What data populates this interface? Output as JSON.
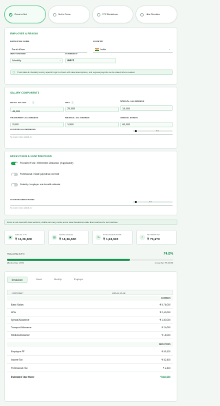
{
  "tabs": [
    {
      "label": "Gross to Net",
      "active": true
    },
    {
      "label": "Net to Gross",
      "active": false
    },
    {
      "label": "CTC Breakdown",
      "active": false
    },
    {
      "label": "Hike Simulator",
      "active": false
    }
  ],
  "employee": {
    "title": "EMPLOYEE & REGION",
    "name_label": "EMPLOYEE NAME",
    "name_value": "Sarah Khan",
    "country_label": "COUNTRY",
    "country_value": "India",
    "period_label": "INPUT PERIOD",
    "period_value": "Monthly",
    "currency_label": "CURRENCY",
    "currency_value": "INR ₹",
    "note": "Trust slabs & cheddar( country-specific logic is shown with clear assumptions, and regional payrolls can be stated where needed."
  },
  "salary": {
    "title": "SALARY COMPONENTS",
    "fields": [
      {
        "label": "BASIC SALARY",
        "value": "48,000"
      },
      {
        "label": "HRA",
        "value": "20,000"
      },
      {
        "label": "SPECIAL ALLOWANCE",
        "value": "15,000"
      },
      {
        "label": "TRANSPORT ALLOWANCE",
        "value": "2,000"
      },
      {
        "label": "MEDICAL ALLOWANCE",
        "value": "1,500"
      },
      {
        "label": "ANNUAL BONUS",
        "value": "60,000"
      }
    ],
    "custom_label": "CUSTOM ALLOWANCES",
    "custom_value": "₹ 0",
    "custom_help": "No custom items added yet"
  },
  "deductions": {
    "title": "DEDUCTIONS & CONTRIBUTIONS",
    "toggles": [
      {
        "label": "Provident Fund / Retirement Deduction (if applicable)",
        "on": true
      },
      {
        "label": "Professional / State payroll tax override",
        "on": false
      },
      {
        "label": "Gratuity / employer end-benefit estimate",
        "on": false
      }
    ],
    "custom_label": "CUSTOM DEDUCTIONS",
    "custom_value": "₹ 0",
    "custom_help": "No custom items added yet"
  },
  "banner": "Gross to net view with clear sections, visible summary cards, and a clean breakdown table that matches the tool interface.",
  "stats": [
    {
      "icon": "wallet-icon",
      "glyph": "▣",
      "label": "ANNUAL CTC",
      "value": "₹ 11,20,300"
    },
    {
      "icon": "cash-icon",
      "glyph": "▤",
      "label": "GROSS ANNUAL",
      "value": "₹ 10,36,000"
    },
    {
      "icon": "percent-icon",
      "glyph": "%",
      "label": "TOTAL DEDUCTIONS",
      "value": "₹ 1,53,020"
    },
    {
      "icon": "check-icon",
      "glyph": "✓",
      "label": "NET MONTHLY",
      "value": "₹ 73,673"
    }
  ],
  "take_home": {
    "label": "TAKE-HOME RATIO",
    "percent": "74.0%",
    "fill": 0.74,
    "effective": "Effective Rate: 16.8%",
    "annual": "Annual Net: ₹ 8,84,080"
  },
  "view_tabs": [
    "Breakdown",
    "Visual",
    "Monthly",
    "Employer"
  ],
  "table": {
    "col_component": "COMPONENT",
    "col_annual": "ANNUAL VALUE",
    "earnings_label": "EARNINGS",
    "earnings": [
      {
        "name": "Basic Salary",
        "value": "₹ 5,76,000"
      },
      {
        "name": "HRA",
        "value": "₹ 2,40,000"
      },
      {
        "name": "Special Allowance",
        "value": "₹ 1,80,000"
      },
      {
        "name": "Transport Allowance",
        "value": "₹ 24,000"
      },
      {
        "name": "Medical Allowance",
        "value": "₹ 18,000"
      }
    ],
    "deductions_label": "DEDUCTIONS",
    "deductions": [
      {
        "name": "Employee PF",
        "value": "₹ 69,120"
      },
      {
        "name": "Income Tax",
        "value": "₹ 82,400"
      },
      {
        "name": "Professional Tax",
        "value": "₹ 2,400"
      }
    ],
    "total": {
      "name": "Estimated Take Home",
      "value": "₹ 884,080"
    }
  },
  "colors": {
    "accent": "#1e8f52",
    "accent_light": "#eaf7ef"
  }
}
